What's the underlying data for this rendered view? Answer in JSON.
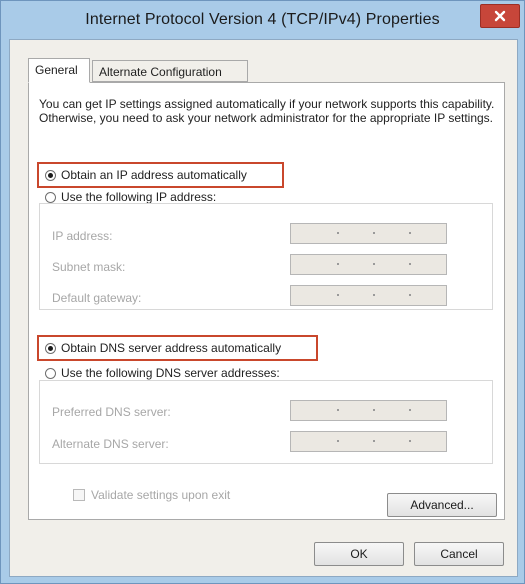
{
  "window": {
    "title": "Internet Protocol Version 4 (TCP/IPv4) Properties"
  },
  "tabs": [
    {
      "label": "General",
      "active": true
    },
    {
      "label": "Alternate Configuration",
      "active": false
    }
  ],
  "description": "You can get IP settings assigned automatically if your network supports this capability. Otherwise, you need to ask your network administrator for the appropriate IP settings.",
  "ip_section": {
    "auto_label": "Obtain an IP address automatically",
    "auto_selected": true,
    "manual_label": "Use the following IP address:",
    "fields": [
      {
        "label": "IP address:"
      },
      {
        "label": "Subnet mask:"
      },
      {
        "label": "Default gateway:"
      }
    ]
  },
  "dns_section": {
    "auto_label": "Obtain DNS server address automatically",
    "auto_selected": true,
    "manual_label": "Use the following DNS server addresses:",
    "fields": [
      {
        "label": "Preferred DNS server:"
      },
      {
        "label": "Alternate DNS server:"
      }
    ]
  },
  "validate": {
    "label": "Validate settings upon exit",
    "checked": false
  },
  "buttons": {
    "advanced": "Advanced...",
    "ok": "OK",
    "cancel": "Cancel"
  },
  "colors": {
    "frame": "#a9cbe8",
    "highlight": "#c9472c",
    "close": "#c7463a"
  }
}
